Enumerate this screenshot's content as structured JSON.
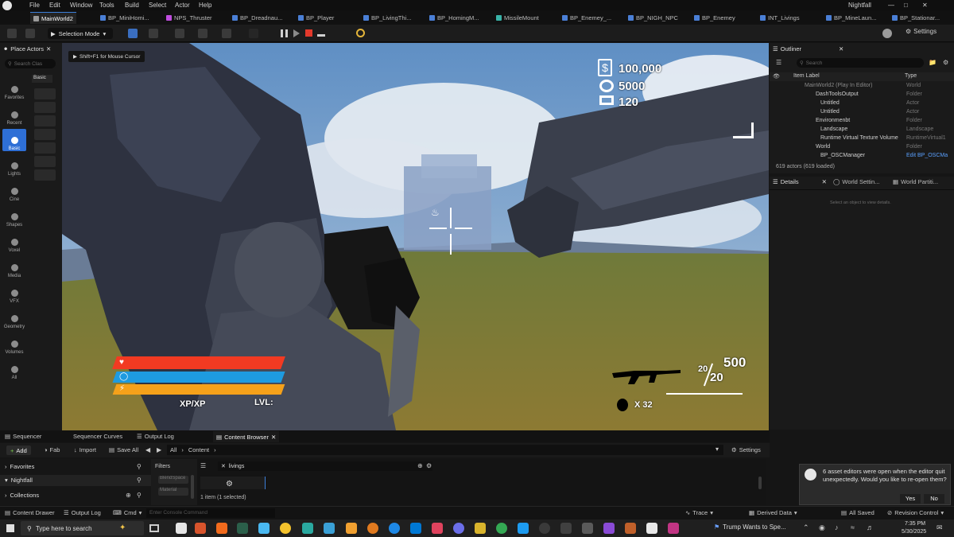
{
  "menu": {
    "items": [
      "File",
      "Edit",
      "Window",
      "Tools",
      "Build",
      "Select",
      "Actor",
      "Help"
    ],
    "project": "Nightfall"
  },
  "tabs": [
    "MainWorld2",
    "BP_MiniHomi...",
    "NPS_Thruster",
    "BP_Dreadnau...",
    "BP_Player",
    "BP_LivingThi...",
    "BP_HomingM...",
    "MissileMount",
    "BP_Enemey_...",
    "BP_NIGH_NPC",
    "BP_Enemey",
    "INT_Livings",
    "BP_MineLaun...",
    "BP_Stationar..."
  ],
  "toolbar": {
    "mode": "Selection Mode",
    "settings": "Settings"
  },
  "place_actors": {
    "title": "Place Actors",
    "search_placeholder": "Search Clas",
    "tab": "Basic",
    "categories": [
      "Favorites",
      "Recent",
      "Basic",
      "Lights",
      "Cine",
      "Shapes",
      "Voxel",
      "Media",
      "VFX",
      "Geometry",
      "Volumes",
      "All"
    ]
  },
  "viewport": {
    "hint": "Shift+F1 for Mouse Cursor"
  },
  "hud": {
    "money": "100,000",
    "gear": "5000",
    "ammo_reserve": "120",
    "ammo_total": "500",
    "mag_current": "20",
    "mag_max": "20",
    "grenades": "X 32",
    "xp": "XP/XP",
    "level": "LVL:",
    "health_color": "#f23a22",
    "shield_color": "#1e9be0",
    "stamina_color": "#f5a11a"
  },
  "outliner": {
    "title": "Outliner",
    "search_placeholder": "Search",
    "col_label": "Item Label",
    "col_type": "Type",
    "rows": [
      {
        "label": "MainWorld2 (Play In Editor)",
        "type": "World"
      },
      {
        "label": "DashToolsOutput",
        "type": "Folder"
      },
      {
        "label": "Untitled",
        "type": "Actor"
      },
      {
        "label": "Untitled",
        "type": "Actor"
      },
      {
        "label": "Environmenbt",
        "type": "Folder"
      },
      {
        "label": "Landscape",
        "type": "Landscape"
      },
      {
        "label": "Runtime Virtual Texture Volume",
        "type": "RuntimeVirtual1"
      },
      {
        "label": "World",
        "type": "Folder"
      },
      {
        "label": "BP_OSCManager",
        "type": "Edit BP_OSCMa"
      }
    ],
    "count": "619 actors (619 loaded)"
  },
  "details": {
    "tabs": [
      "Details",
      "World Settin...",
      "World Partiti..."
    ],
    "empty": "Select an object to view details."
  },
  "bottom_tabs": [
    "Sequencer",
    "Sequencer Curves",
    "Output Log",
    "Content Browser"
  ],
  "content_browser": {
    "add": "Add",
    "fab": "Fab",
    "import": "Import",
    "save_all": "Save All",
    "path": [
      "All",
      "Content"
    ],
    "settings": "Settings",
    "favorites": "Favorites",
    "project": "Nightfall",
    "collections": "Collections",
    "filters": "Filters",
    "filter_items": [
      "BléndSpace",
      "Material"
    ],
    "search_value": "livings",
    "selection": "1 item (1 selected)"
  },
  "statusbar": {
    "content_drawer": "Content Drawer",
    "output_log": "Output Log",
    "cmd": "Cmd",
    "console_placeholder": "Enter Console Command",
    "trace": "Trace",
    "derived_data": "Derived Data",
    "all_saved": "All Saved",
    "revision": "Revision Control"
  },
  "toast": {
    "message": "6 asset editors were open when the editor quit unexpectedly. Would you like to re-open them?",
    "yes": "Yes",
    "no": "No"
  },
  "taskbar": {
    "search_placeholder": "Type here to search",
    "news": "Trump Wants to Spe...",
    "time": "7:35 PM",
    "date": "5/30/2025"
  }
}
